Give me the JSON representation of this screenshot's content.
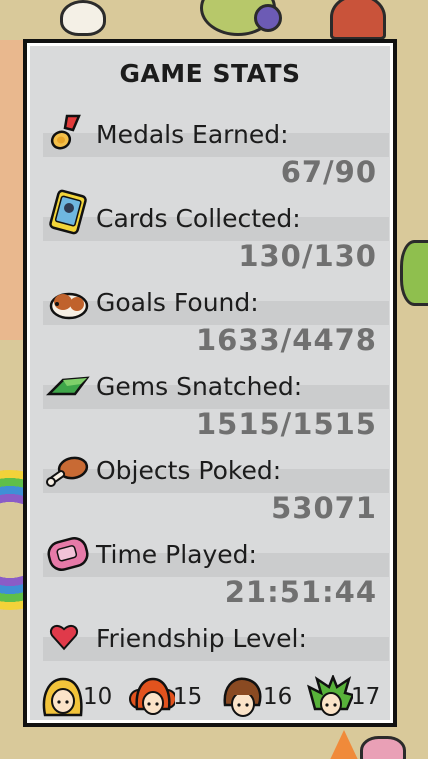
{
  "title": "GAME STATS",
  "stats": [
    {
      "label": "Medals Earned:",
      "value": "67/90",
      "icon": "medal-icon"
    },
    {
      "label": "Cards Collected:",
      "value": "130/130",
      "icon": "card-icon"
    },
    {
      "label": "Goals Found:",
      "value": "1633/4478",
      "icon": "guinea-pig-icon"
    },
    {
      "label": "Gems Snatched:",
      "value": "1515/1515",
      "icon": "gem-icon"
    },
    {
      "label": "Objects Poked:",
      "value": "53071",
      "icon": "drumstick-icon"
    },
    {
      "label": "Time Played:",
      "value": "21:51:44",
      "icon": "handheld-console-icon"
    },
    {
      "label": "Friendship Level:",
      "value": "",
      "icon": "heart-icon"
    }
  ],
  "friends": [
    {
      "level": "10",
      "icon": "blonde-girl-avatar-icon",
      "hair_color": "#f2c33a"
    },
    {
      "level": "15",
      "icon": "red-hair-girl-avatar-icon",
      "hair_color": "#e2531e"
    },
    {
      "level": "16",
      "icon": "brown-hair-boy-avatar-icon",
      "hair_color": "#8a4a22"
    },
    {
      "level": "17",
      "icon": "green-hair-girl-avatar-icon",
      "hair_color": "#58b23a"
    }
  ],
  "colors": {
    "panel_bg": "#d9dadb",
    "row_bar": "#cbcccd",
    "value_text": "#707070",
    "label_text": "#1c1c1c"
  }
}
